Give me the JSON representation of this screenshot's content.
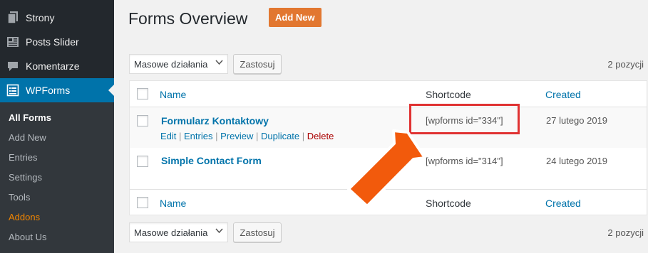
{
  "sidebar": {
    "items": [
      {
        "label": "Strony",
        "icon": "pages-icon"
      },
      {
        "label": "Posts Slider",
        "icon": "slider-icon"
      },
      {
        "label": "Komentarze",
        "icon": "comments-icon"
      },
      {
        "label": "WPForms",
        "icon": "wpforms-icon"
      }
    ],
    "submenu": [
      "All Forms",
      "Add New",
      "Entries",
      "Settings",
      "Tools",
      "Addons",
      "About Us"
    ]
  },
  "header": {
    "title": "Forms Overview",
    "add_new": "Add New"
  },
  "tablenav": {
    "bulk_label": "Masowe działania",
    "apply_label": "Zastosuj",
    "count": "2 pozycji"
  },
  "table": {
    "columns": {
      "name": "Name",
      "shortcode": "Shortcode",
      "created": "Created"
    },
    "rows": [
      {
        "name": "Formularz Kontaktowy",
        "shortcode": "[wpforms id=\"334\"]",
        "created": "27 lutego 2019",
        "actions": [
          "Edit",
          "Entries",
          "Preview",
          "Duplicate",
          "Delete"
        ]
      },
      {
        "name": "Simple Contact Form",
        "shortcode": "[wpforms id=\"314\"]",
        "created": "24 lutego 2019"
      }
    ]
  },
  "colors": {
    "accent": "#0073aa",
    "add_new": "#e27730",
    "arrow": "#f25a0c",
    "highlight": "#e03232",
    "addons": "#f18500"
  }
}
